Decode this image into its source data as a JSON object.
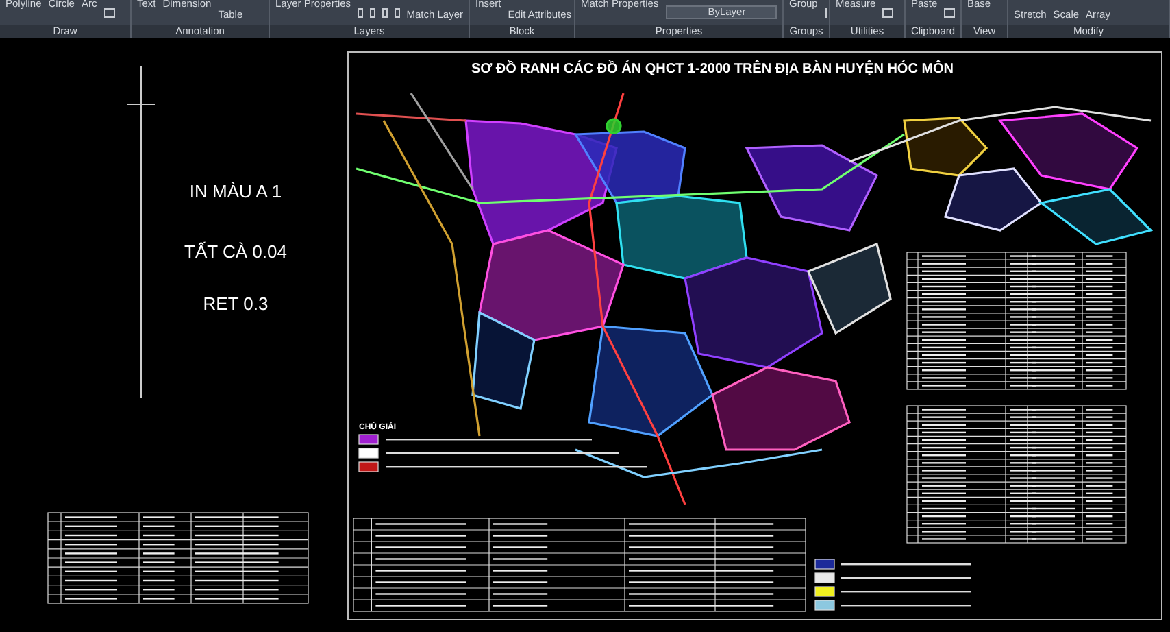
{
  "ribbon": {
    "groups": [
      {
        "label": "Draw",
        "tools": [
          {
            "label": "Polyline",
            "kind": "large"
          },
          {
            "label": "Circle",
            "kind": "large"
          },
          {
            "label": "Arc",
            "kind": "large"
          },
          {
            "kind": "icon"
          }
        ]
      },
      {
        "label": "Annotation",
        "tools": [
          {
            "label": "Text",
            "kind": "large"
          },
          {
            "label": "Dimension",
            "kind": "large"
          },
          {
            "label": "Table",
            "kind": "small"
          }
        ]
      },
      {
        "label": "Layers",
        "tools": [
          {
            "label": "Layer Properties",
            "kind": "large"
          },
          {
            "kind": "icon"
          },
          {
            "kind": "icon"
          },
          {
            "kind": "icon"
          },
          {
            "kind": "icon"
          },
          {
            "label": "Match Layer",
            "kind": "small"
          }
        ]
      },
      {
        "label": "Block",
        "tools": [
          {
            "label": "Insert",
            "kind": "large"
          },
          {
            "label": "Edit Attributes",
            "kind": "small"
          }
        ]
      },
      {
        "label": "Properties",
        "tools": [
          {
            "label": "Match Properties",
            "kind": "large"
          },
          {
            "label": "ByLayer",
            "kind": "dropdown"
          }
        ]
      },
      {
        "label": "Groups",
        "tools": [
          {
            "label": "Group",
            "kind": "large"
          },
          {
            "kind": "icon"
          }
        ]
      },
      {
        "label": "Utilities",
        "tools": [
          {
            "label": "Measure",
            "kind": "large"
          },
          {
            "kind": "icon"
          }
        ]
      },
      {
        "label": "Clipboard",
        "tools": [
          {
            "label": "Paste",
            "kind": "large"
          },
          {
            "kind": "icon"
          }
        ]
      },
      {
        "label": "View",
        "tools": [
          {
            "label": "Base",
            "kind": "large"
          }
        ]
      },
      {
        "label": "Modify",
        "tools": [
          {
            "label": "Stretch",
            "kind": "small"
          },
          {
            "label": "Scale",
            "kind": "small"
          },
          {
            "label": "Array",
            "kind": "small"
          }
        ]
      }
    ]
  },
  "notes": [
    "IN MÀU A 1",
    "TẤT CÀ 0.04",
    "RET 0.3"
  ],
  "drawing": {
    "title": "SƠ ĐỒ RANH CÁC ĐỒ ÁN QHCT 1-2000 TRÊN ĐỊA BÀN HUYỆN HÓC MÔN",
    "legend_title": "CHÚ GIẢI",
    "legend": [
      {
        "color": "#a020d0"
      },
      {
        "color": "#ffffff"
      },
      {
        "color": "#c01818"
      }
    ],
    "legend_2": [
      {
        "color": "#1c2a9a"
      },
      {
        "color": "#e8e8e8"
      },
      {
        "color": "#f0f020"
      },
      {
        "color": "#8cc8e0"
      }
    ]
  }
}
